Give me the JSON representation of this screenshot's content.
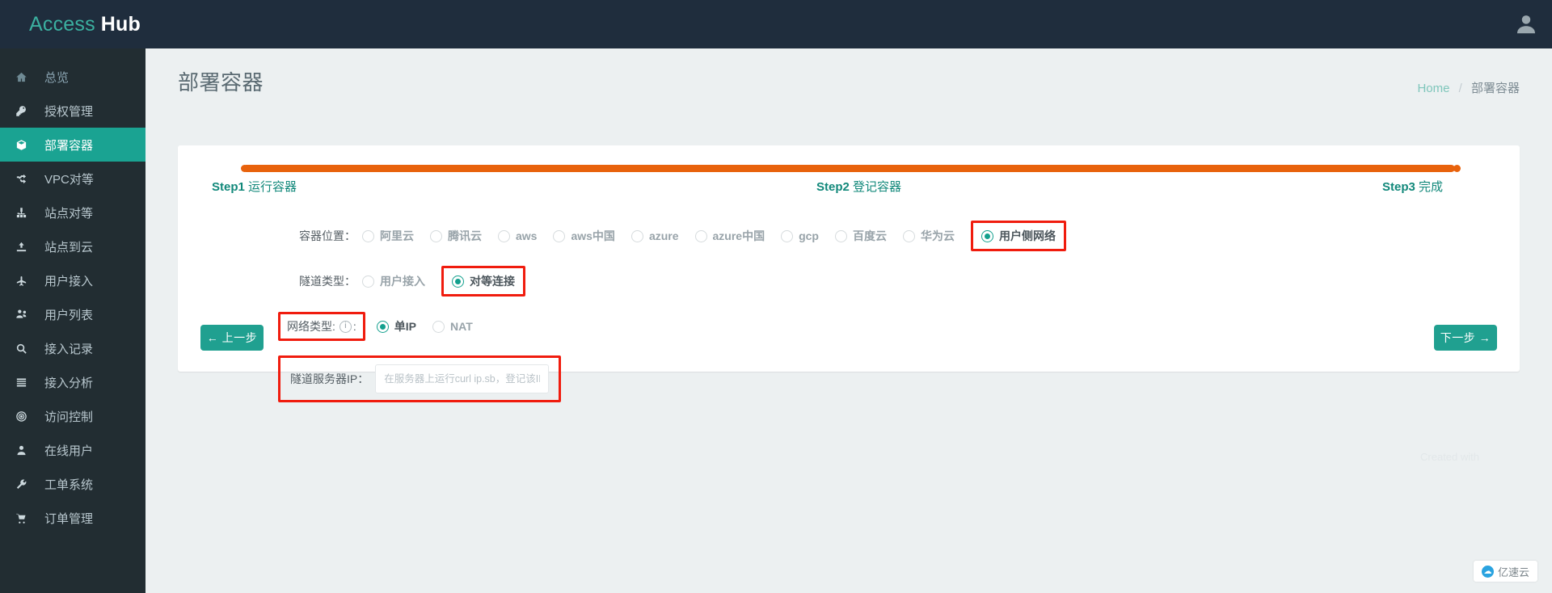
{
  "header": {
    "brand_first": "Access",
    "brand_second": "Hub",
    "avatar_icon": "user-avatar-icon"
  },
  "sidebar": {
    "items": [
      {
        "label": "总览",
        "icon": "home-icon",
        "active": false,
        "dim": true
      },
      {
        "label": "授权管理",
        "icon": "key-icon",
        "active": false,
        "dim": false
      },
      {
        "label": "部署容器",
        "icon": "cube-icon",
        "active": true,
        "dim": false
      },
      {
        "label": "VPC对等",
        "icon": "shuffle-icon",
        "active": false,
        "dim": false
      },
      {
        "label": "站点对等",
        "icon": "sitemap-icon",
        "active": false,
        "dim": false
      },
      {
        "label": "站点到云",
        "icon": "upload-icon",
        "active": false,
        "dim": false
      },
      {
        "label": "用户接入",
        "icon": "plane-icon",
        "active": false,
        "dim": false
      },
      {
        "label": "用户列表",
        "icon": "users-icon",
        "active": false,
        "dim": false
      },
      {
        "label": "接入记录",
        "icon": "search-icon",
        "active": false,
        "dim": false
      },
      {
        "label": "接入分析",
        "icon": "list-icon",
        "active": false,
        "dim": false
      },
      {
        "label": "访问控制",
        "icon": "target-icon",
        "active": false,
        "dim": false
      },
      {
        "label": "在线用户",
        "icon": "person-icon",
        "active": false,
        "dim": false
      },
      {
        "label": "工单系统",
        "icon": "wrench-icon",
        "active": false,
        "dim": false
      },
      {
        "label": "订单管理",
        "icon": "cart-icon",
        "active": false,
        "dim": false
      }
    ]
  },
  "page": {
    "title": "部署容器",
    "breadcrumb_home": "Home",
    "breadcrumb_sep": "/",
    "breadcrumb_current": "部署容器"
  },
  "stepper": {
    "progress_color": "#e8620c",
    "steps": [
      {
        "num": "Step1",
        "name": "运行容器"
      },
      {
        "num": "Step2",
        "name": "登记容器"
      },
      {
        "num": "Step3",
        "name": "完成"
      }
    ]
  },
  "form": {
    "location": {
      "label": "容器位置：",
      "options": [
        {
          "text": "阿里云",
          "selected": false
        },
        {
          "text": "腾讯云",
          "selected": false
        },
        {
          "text": "aws",
          "selected": false
        },
        {
          "text": "aws中国",
          "selected": false
        },
        {
          "text": "azure",
          "selected": false
        },
        {
          "text": "azure中国",
          "selected": false
        },
        {
          "text": "gcp",
          "selected": false
        },
        {
          "text": "百度云",
          "selected": false
        },
        {
          "text": "华为云",
          "selected": false
        }
      ],
      "highlighted_option": {
        "text": "用户侧网络",
        "selected": true
      }
    },
    "tunnel_type": {
      "label": "隧道类型：",
      "options": [
        {
          "text": "用户接入",
          "selected": false
        }
      ],
      "highlighted_option": {
        "text": "对等连接",
        "selected": true
      }
    },
    "network_type": {
      "label": "网络类型:",
      "info_icon": "info-circle-icon",
      "suffix": ":",
      "options": [
        {
          "text": "单IP",
          "selected": true
        },
        {
          "text": "NAT",
          "selected": false
        }
      ]
    },
    "tunnel_ip": {
      "label": "隧道服务器IP：",
      "placeholder": "在服务器上运行curl ip.sb，登记该IP",
      "value": ""
    }
  },
  "footer": {
    "prev_label": "← 上一步",
    "next_label": "下一步 →"
  },
  "watermark": {
    "created_with": "Created with",
    "badge_text": "亿速云",
    "badge_icon": "cloud-icon"
  },
  "colors": {
    "accent_teal": "#1aa392",
    "sidebar_bg": "#222d32",
    "topbar_bg": "#1f2d3d",
    "progress_orange": "#e8620c",
    "annotation_red": "#f01c0e"
  }
}
